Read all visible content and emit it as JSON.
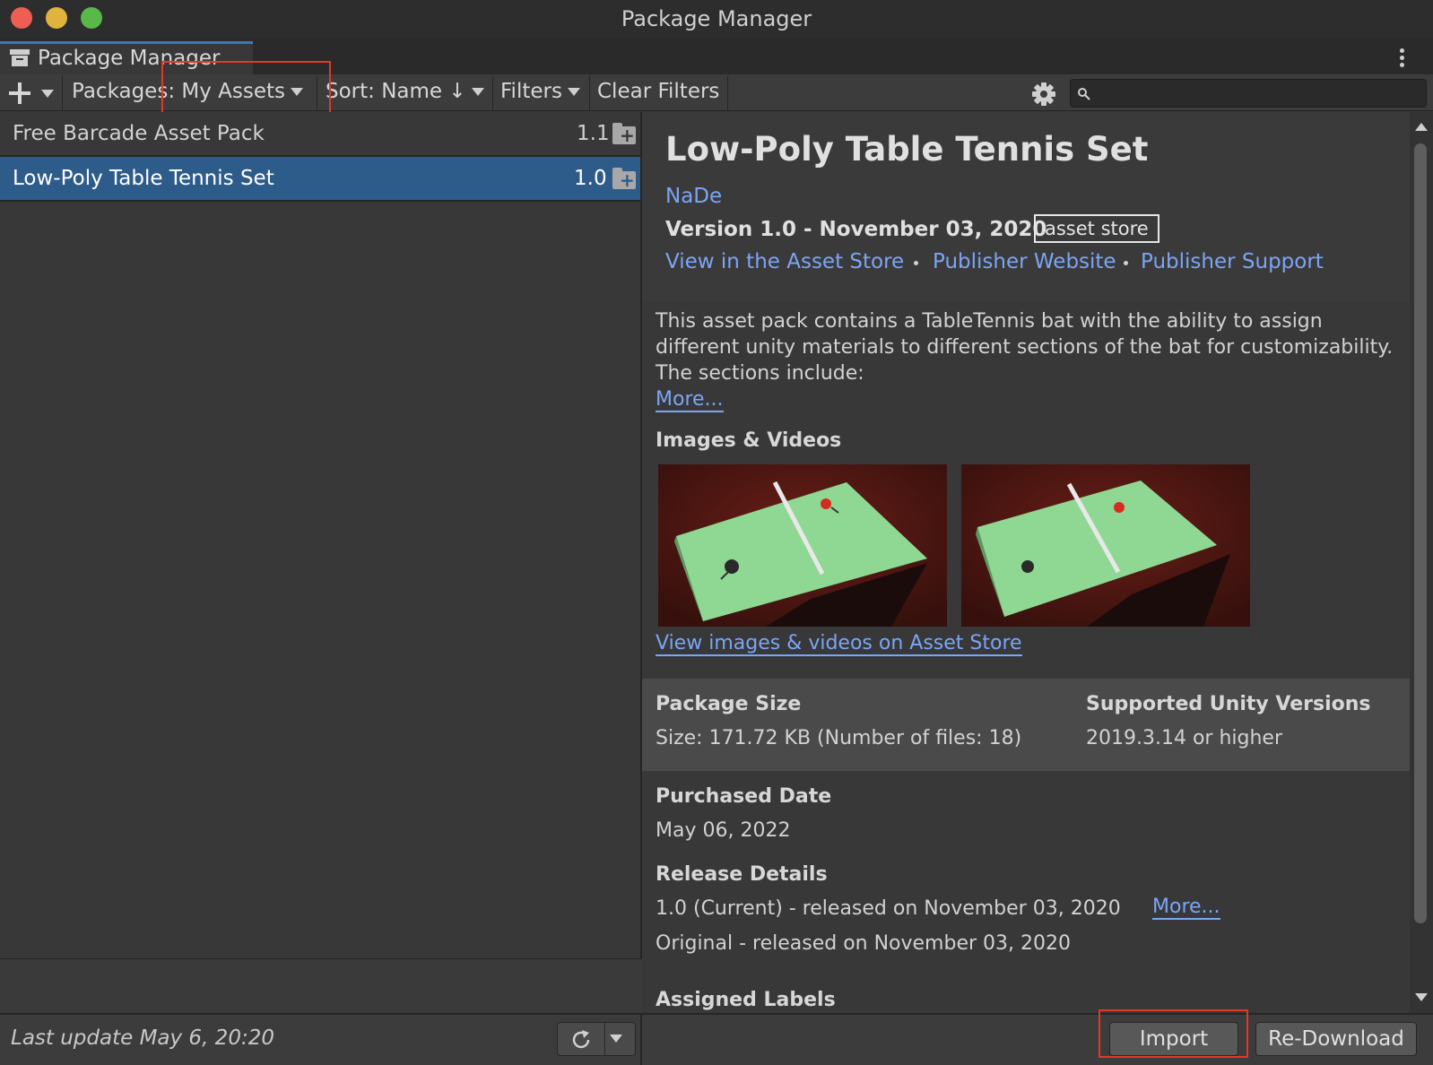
{
  "window": {
    "title": "Package Manager"
  },
  "tab": {
    "label": "Package Manager"
  },
  "toolbar": {
    "packages_label": "Packages: My Assets",
    "sort_label": "Sort: Name ↓",
    "filters_label": "Filters",
    "clear_filters_label": "Clear Filters",
    "search_placeholder": ""
  },
  "packages": [
    {
      "name": "Free Barcade Asset Pack",
      "version": "1.1",
      "selected": false
    },
    {
      "name": "Low-Poly Table Tennis Set",
      "version": "1.0",
      "selected": true
    }
  ],
  "status": {
    "last_update": "Last update May 6, 20:20"
  },
  "detail": {
    "title": "Low-Poly Table Tennis Set",
    "author": "NaDe",
    "version_line": "Version 1.0 - November 03, 2020",
    "source_tag": "asset store",
    "links": {
      "view_store": "View in the Asset Store",
      "publisher_website": "Publisher Website",
      "publisher_support": "Publisher Support"
    },
    "description": [
      "This asset pack contains a TableTennis bat with the ability to assign",
      "different unity materials to different sections of the bat for customizability.",
      "The sections include:"
    ],
    "more_label": "More...",
    "images_heading": "Images & Videos",
    "images_link": "View images & videos on Asset Store",
    "package_size_heading": "Package Size",
    "package_size_value": "Size: 171.72 KB (Number of files: 18)",
    "supported_heading": "Supported Unity Versions",
    "supported_value": "2019.3.14 or higher",
    "purchased_heading": "Purchased Date",
    "purchased_value": "May 06, 2022",
    "release_heading": "Release Details",
    "release_current": "1.0 (Current) - released on November 03, 2020",
    "release_more": "More...",
    "release_original": "Original - released on November 03, 2020",
    "labels_heading": "Assigned Labels"
  },
  "footer": {
    "import_label": "Import",
    "redownload_label": "Re-Download"
  },
  "colors": {
    "accent": "#3a79bb",
    "selection": "#2d5c8a",
    "link": "#7ba5f5",
    "highlight_box": "#e03a26"
  }
}
